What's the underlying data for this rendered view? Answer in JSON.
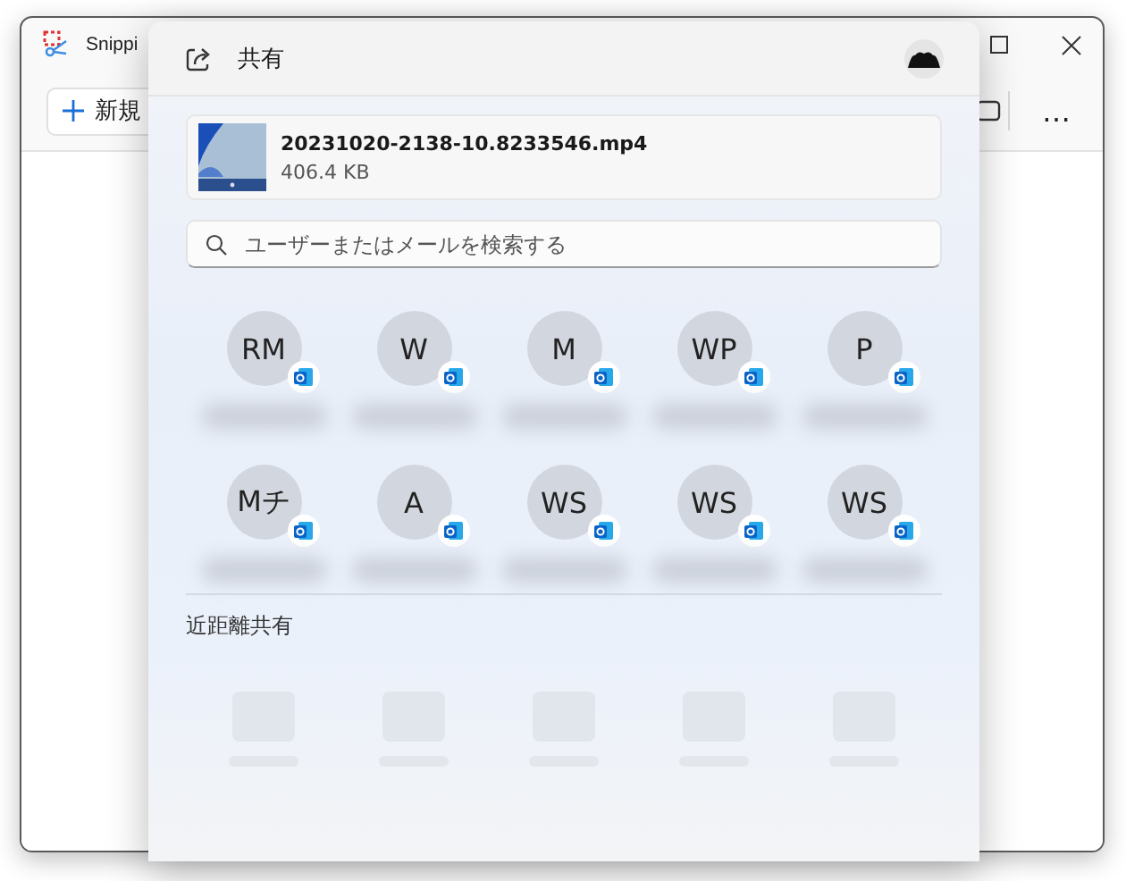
{
  "window": {
    "title": "Snippi",
    "new_button": "新規",
    "more_button": "…"
  },
  "share": {
    "title": "共有",
    "file": {
      "name": "20231020-2138-10.8233546.mp4",
      "size": "406.4 KB"
    },
    "search": {
      "placeholder": "ユーザーまたはメールを検索する"
    },
    "contacts": [
      {
        "initials": "RM"
      },
      {
        "initials": "W"
      },
      {
        "initials": "M"
      },
      {
        "initials": "WP"
      },
      {
        "initials": "P"
      },
      {
        "initials": "Mチ"
      },
      {
        "initials": "A"
      },
      {
        "initials": "WS"
      },
      {
        "initials": "WS"
      },
      {
        "initials": "WS"
      }
    ],
    "nearby": {
      "title": "近距離共有"
    }
  }
}
